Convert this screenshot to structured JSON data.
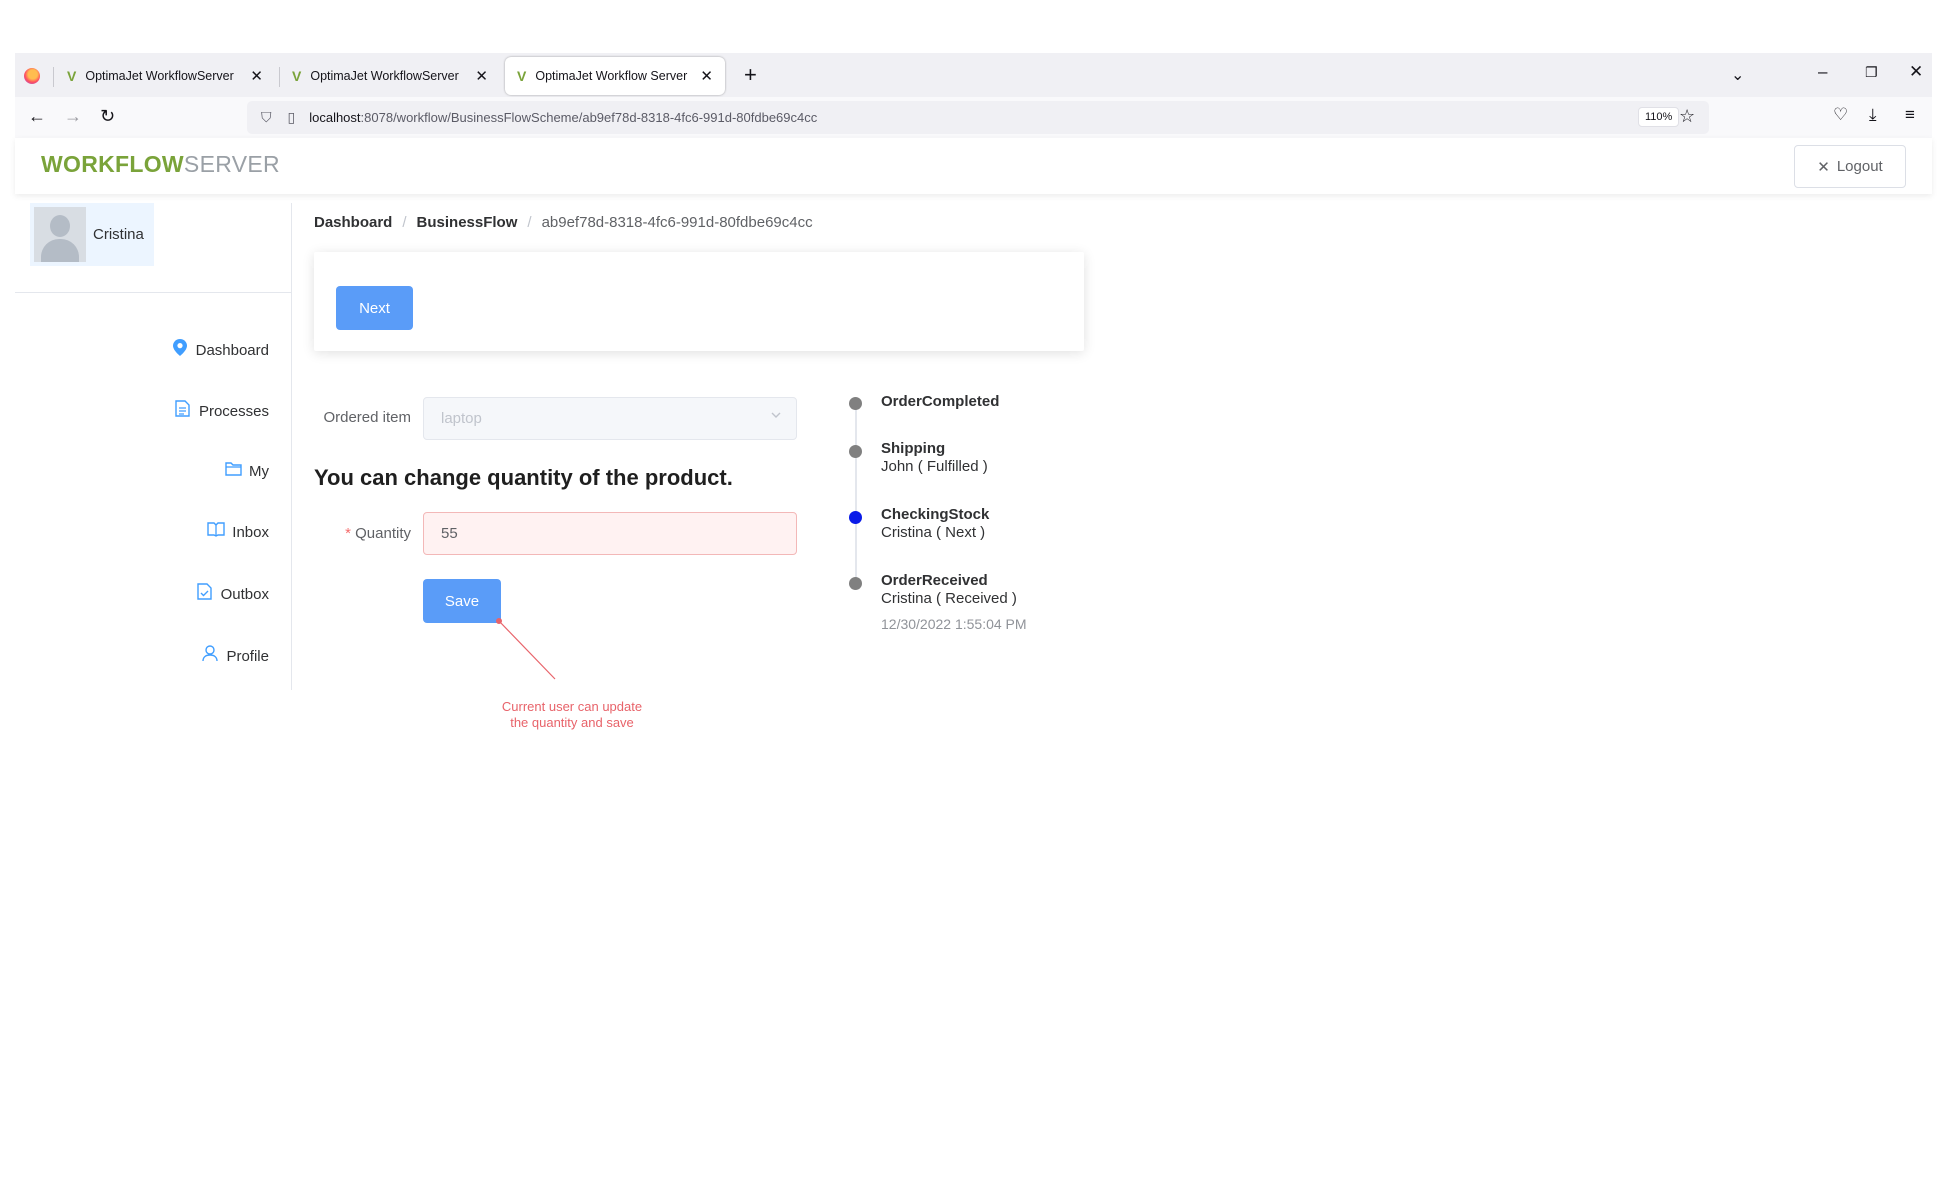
{
  "browser": {
    "tabs": [
      {
        "label": "OptimaJet WorkflowServer"
      },
      {
        "label": "OptimaJet WorkflowServer"
      },
      {
        "label": "OptimaJet Workflow Server"
      }
    ],
    "url": {
      "host": "localhost",
      "rest": ":8078/workflow/BusinessFlowScheme/ab9ef78d-8318-4fc6-991d-80fdbe69c4cc"
    },
    "zoom": "110%"
  },
  "header": {
    "logo_part1": "WORKFLOW",
    "logo_part2": "SERVER",
    "logout_label": "Logout"
  },
  "sidebar": {
    "user_name": "Cristina",
    "items": [
      {
        "label": "Dashboard",
        "icon": "location-pin-icon"
      },
      {
        "label": "Processes",
        "icon": "document-icon"
      },
      {
        "label": "My",
        "icon": "folder-icon"
      },
      {
        "label": "Inbox",
        "icon": "book-icon"
      },
      {
        "label": "Outbox",
        "icon": "document-check-icon"
      },
      {
        "label": "Profile",
        "icon": "user-icon"
      }
    ]
  },
  "breadcrumb": {
    "items": [
      "Dashboard",
      "BusinessFlow",
      "ab9ef78d-8318-4fc6-991d-80fdbe69c4cc"
    ]
  },
  "actions": {
    "next_label": "Next"
  },
  "form": {
    "ordered_item_label": "Ordered item",
    "ordered_item_value": "laptop",
    "heading": "You can change quantity of the product.",
    "quantity_required_mark": "*",
    "quantity_label": "Quantity",
    "quantity_value": "55",
    "save_label": "Save"
  },
  "annotation": {
    "line1": "Current user can update",
    "line2": "the quantity and save",
    "color": "#e8636a"
  },
  "timeline": {
    "items": [
      {
        "title": "OrderCompleted",
        "sub": "",
        "time": "",
        "active": false
      },
      {
        "title": "Shipping",
        "sub": "John ( Fulfilled )",
        "time": "",
        "active": false
      },
      {
        "title": "CheckingStock",
        "sub": "Cristina ( Next )",
        "time": "",
        "active": true
      },
      {
        "title": "OrderReceived",
        "sub": "Cristina ( Received )",
        "time": "12/30/2022 1:55:04 PM",
        "active": false
      }
    ],
    "active_color": "#0a1be8",
    "inactive_color": "#808080"
  },
  "colors": {
    "primary": "#5a9cf8",
    "brand_green": "#7aa33a"
  }
}
